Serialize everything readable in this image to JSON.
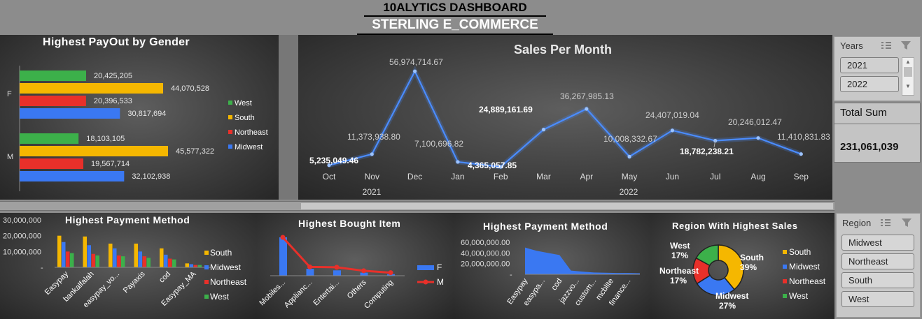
{
  "header": {
    "line1": "10ALYTICS DASHBOARD",
    "line2": "STERLING E_COMMERCE"
  },
  "years_slicer": {
    "title": "Years",
    "items": [
      "2021",
      "2022"
    ],
    "selected": "2021"
  },
  "total": {
    "label": "Total Sum",
    "value": "231,061,039"
  },
  "region_slicer": {
    "title": "Region",
    "items": [
      "Midwest",
      "Northeast",
      "South",
      "West"
    ]
  },
  "colors": {
    "West": "#3cb04a",
    "South": "#f5b700",
    "Northeast": "#e8302a",
    "Midwest": "#3a78f2",
    "line": "#4a8cff",
    "F": "#3a78f2",
    "M": "#e8302a"
  },
  "chart_data": [
    {
      "type": "bar",
      "title": "Highest PayOut by Gender",
      "orientation": "horizontal",
      "categories": [
        "F",
        "M"
      ],
      "series": [
        {
          "name": "West",
          "values": [
            20425205,
            18103105
          ],
          "labels": [
            "20,425,205",
            "18,103,105"
          ]
        },
        {
          "name": "South",
          "values": [
            44070528,
            45577322
          ],
          "labels": [
            "44,070,528",
            "45,577,322"
          ]
        },
        {
          "name": "Northeast",
          "values": [
            20396533,
            19567714
          ],
          "labels": [
            "20,396,533",
            "19,567,714"
          ]
        },
        {
          "name": "Midwest",
          "values": [
            30817694,
            32102938
          ],
          "labels": [
            "30,817,694",
            "32,102,938"
          ]
        }
      ],
      "legend": "right"
    },
    {
      "type": "line",
      "title": "Sales Per Month",
      "x": [
        "Oct",
        "Nov",
        "Dec",
        "Jan",
        "Feb",
        "Mar",
        "Apr",
        "May",
        "Jun",
        "Jul",
        "Aug",
        "Sep"
      ],
      "year_groups": [
        {
          "label": "2021",
          "months": 3
        },
        {
          "label": "2022",
          "months": 9
        }
      ],
      "values": [
        5235049.46,
        11373938.8,
        56974714.67,
        7100696.82,
        4365057.85,
        24889161.69,
        36267985.13,
        10008332.67,
        24407019.04,
        18782238.21,
        20246012.47,
        11410831.83
      ],
      "labels": [
        "5,235,049.46",
        "11,373,938.80",
        "56,974,714.67",
        "7,100,696.82",
        "4,365,057.85",
        "24,889,161.69",
        "36,267,985.13",
        "10,008,332.67",
        "24,407,019.04",
        "18,782,238.21",
        "20,246,012.47",
        "11,410,831.83"
      ]
    },
    {
      "type": "bar",
      "title": "Highest Payment Method",
      "categories": [
        "Easypay",
        "bankalfalah",
        "easypay_vo...",
        "Payaxis",
        "cod",
        "Easypay_MA"
      ],
      "yticks": [
        "30,000,000",
        "20,000,000",
        "10,000,000",
        "-"
      ],
      "ylim": [
        0,
        30000000
      ],
      "series": [
        {
          "name": "South",
          "values": [
            20000000,
            19500000,
            15000000,
            15000000,
            12000000,
            2500000
          ]
        },
        {
          "name": "Midwest",
          "values": [
            16000000,
            14000000,
            12000000,
            10000000,
            8000000,
            2000000
          ]
        },
        {
          "name": "Northeast",
          "values": [
            10000000,
            8500000,
            7500000,
            7000000,
            5500000,
            1500000
          ]
        },
        {
          "name": "West",
          "values": [
            9000000,
            7500000,
            7000000,
            6000000,
            5000000,
            1500000
          ]
        }
      ],
      "legend": "right"
    },
    {
      "type": "bar",
      "title": "Highest Bought Item",
      "categories": [
        "Mobiles...",
        "Applianc...",
        "Entertai...",
        "Others",
        "Computing"
      ],
      "series": [
        {
          "name": "F",
          "type": "bar",
          "values": [
            100,
            18,
            14,
            8,
            4
          ]
        },
        {
          "name": "M",
          "type": "line",
          "values": [
            100,
            23,
            22,
            13,
            8
          ]
        }
      ],
      "legend": "right"
    },
    {
      "type": "area",
      "title": "Highest Payment Method",
      "categories": [
        "Easypay",
        "easypa...",
        "cod",
        "jazzvo...",
        "custom...",
        "mcblite",
        "finance..."
      ],
      "yticks": [
        "60,000,000.00",
        "40,000,000.00",
        "20,000,000.00",
        "-"
      ],
      "ylim": [
        0,
        60000000
      ],
      "values": [
        50000000,
        44000000,
        40000000,
        36000000,
        7000000,
        5000000,
        3500000,
        3000000,
        2500000,
        2500000,
        2000000
      ]
    },
    {
      "type": "pie",
      "title": "Region With Highest Sales",
      "donut": true,
      "slices": [
        {
          "name": "South",
          "value": 39,
          "label": "South",
          "pct": "39%"
        },
        {
          "name": "Midwest",
          "value": 27,
          "label": "Midwest",
          "pct": "27%"
        },
        {
          "name": "Northeast",
          "value": 17,
          "label": "Northeast",
          "pct": "17%"
        },
        {
          "name": "West",
          "value": 17,
          "label": "West",
          "pct": "17%"
        }
      ],
      "legend": [
        "South",
        "Midwest",
        "Northeast",
        "West"
      ]
    }
  ]
}
